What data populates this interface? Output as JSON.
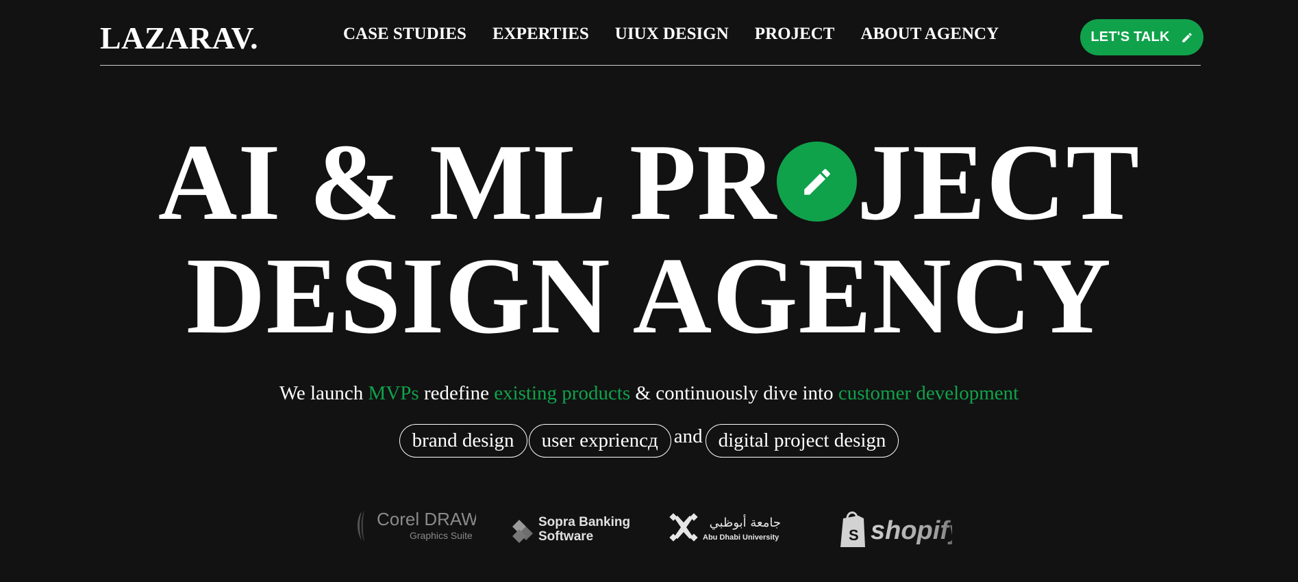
{
  "header": {
    "logo": "LAZARAV.",
    "nav": [
      {
        "label": "CASE STUDIES"
      },
      {
        "label": "EXPERTIES"
      },
      {
        "label": "UIUX DESIGN"
      },
      {
        "label": "PROJECT"
      },
      {
        "label": "ABOUT AGENCY"
      }
    ],
    "cta_label": "LET'S TALK",
    "cta_icon": "pencil-icon"
  },
  "hero": {
    "line1_before": "AI & ML PR",
    "line1_after": "JECT",
    "badge_icon": "pencil-icon",
    "line2": "DESIGN AGENCY"
  },
  "tagline": {
    "part1": "We launch ",
    "hl1": "MVPs",
    "part2": " redefine ",
    "hl2": "existing products",
    "part3": " & continuously dive into ",
    "hl3": "customer development"
  },
  "services": {
    "pills": [
      "brand design",
      "user expriencд",
      "digital project design"
    ],
    "connector": "and"
  },
  "clients": {
    "corel": {
      "name": "Corel DRAW",
      "sub": "Graphics Suite"
    },
    "sopra": {
      "line1": "Sopra Banking",
      "line2": "Software"
    },
    "adu": {
      "arabic": "جامعة أبوظبي",
      "english": "Abu Dhabi University"
    },
    "shopify": {
      "name": "shopify"
    }
  },
  "colors": {
    "background": "#121212",
    "accent": "#10a24b",
    "text": "#ffffff"
  }
}
